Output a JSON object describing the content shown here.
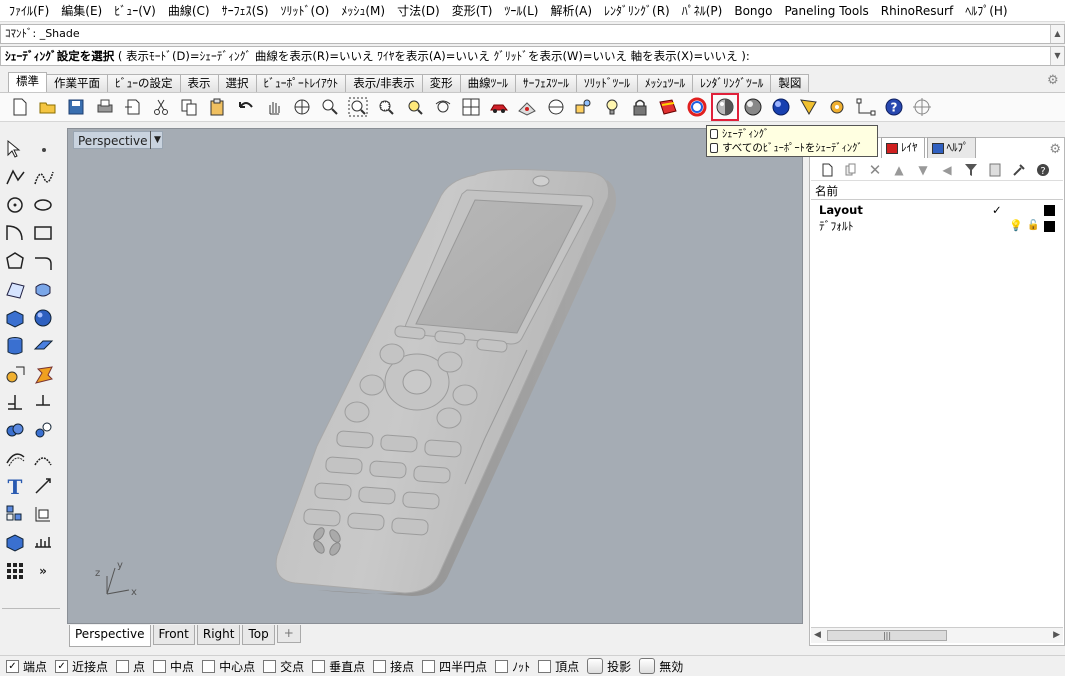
{
  "menu": [
    "ﾌｧｲﾙ(F)",
    "編集(E)",
    "ﾋﾞｭｰ(V)",
    "曲線(C)",
    "ｻｰﾌｪｽ(S)",
    "ｿﾘｯﾄﾞ(O)",
    "ﾒｯｼｭ(M)",
    "寸法(D)",
    "変形(T)",
    "ﾂｰﾙ(L)",
    "解析(A)",
    "ﾚﾝﾀﾞﾘﾝｸﾞ(R)",
    "ﾊﾟﾈﾙ(P)",
    "Bongo",
    "Paneling Tools",
    "RhinoResurf",
    "ﾍﾙﾌﾟ(H)"
  ],
  "command": {
    "history": "ｺﾏﾝﾄﾞ: _Shade",
    "prompt_bold": "ｼｪｰﾃﾞｨﾝｸﾞ設定を選択",
    "prompt_rest": " ( 表示ﾓｰﾄﾞ(D)=ｼｪｰﾃﾞｨﾝｸﾞ  曲線を表示(R)=いいえ  ﾜｲﾔを表示(A)=いいえ  ｸﾞﾘｯﾄﾞを表示(W)=いいえ  軸を表示(X)=いいえ ):"
  },
  "toolbar_tabs": [
    "標準",
    "作業平面",
    "ﾋﾞｭｰの設定",
    "表示",
    "選択",
    "ﾋﾞｭｰﾎﾟｰﾄﾚｲｱｳﾄ",
    "表示/非表示",
    "変形",
    "曲線ﾂｰﾙ",
    "ｻｰﾌｪｽﾂｰﾙ",
    "ｿﾘｯﾄﾞﾂｰﾙ",
    "ﾒｯｼｭﾂｰﾙ",
    "ﾚﾝﾀﾞﾘﾝｸﾞﾂｰﾙ",
    "製図"
  ],
  "active_toolbar_tab": "標準",
  "toolbar_icons": [
    "new-file",
    "open-file",
    "save",
    "print",
    "import",
    "cut",
    "copy",
    "paste",
    "undo",
    "pan",
    "rotate-view",
    "zoom-dynamic",
    "zoom-extents",
    "zoom-window",
    "zoom-selected",
    "undo-view",
    "four-viewports",
    "car-render",
    "cplane",
    "distance",
    "named-view",
    "light",
    "lock",
    "layer-properties",
    "color-wheel",
    "shade",
    "render-preview",
    "render",
    "point-on",
    "options",
    "object-snap",
    "help",
    "crosshair"
  ],
  "highlighted_icon": "shade",
  "tooltip": {
    "line1": "ｼｪｰﾃﾞｨﾝｸﾞ",
    "line2": "すべてのﾋﾞｭｰﾎﾟｰﾄをｼｪｰﾃﾞｨﾝｸﾞ"
  },
  "viewport": {
    "title": "Perspective",
    "bg_color": "#a5acb4",
    "axes": {
      "x": "x",
      "y": "y",
      "z": "z"
    }
  },
  "viewport_tabs": [
    "Perspective",
    "Front",
    "Right",
    "Top"
  ],
  "active_viewport_tab": "Perspective",
  "panel": {
    "tabs": [
      "ﾚｲﾔ",
      "ﾍﾙﾌﾟ"
    ],
    "header": "名前",
    "layers": [
      {
        "name": "Layout",
        "current": true,
        "visible": null,
        "locked": null,
        "color": "#000000"
      },
      {
        "name": "ﾃﾞﾌｫﾙﾄ",
        "current": false,
        "visible": true,
        "locked": false,
        "color": "#000000"
      }
    ]
  },
  "osnaps": [
    {
      "label": "端点",
      "checked": true
    },
    {
      "label": "近接点",
      "checked": true
    },
    {
      "label": "点",
      "checked": false
    },
    {
      "label": "中点",
      "checked": false
    },
    {
      "label": "中心点",
      "checked": false
    },
    {
      "label": "交点",
      "checked": false
    },
    {
      "label": "垂直点",
      "checked": false
    },
    {
      "label": "接点",
      "checked": false
    },
    {
      "label": "四半円点",
      "checked": false
    },
    {
      "label": "ﾉｯﾄ",
      "checked": false
    },
    {
      "label": "頂点",
      "checked": false
    }
  ],
  "status_buttons": [
    "投影",
    "無効"
  ],
  "status_glyphs": {
    "check": "✓",
    "gear": "⚙",
    "plus": "+",
    "bulb": "💡",
    "lock": "🔓",
    "scroll_grip": "|||"
  }
}
